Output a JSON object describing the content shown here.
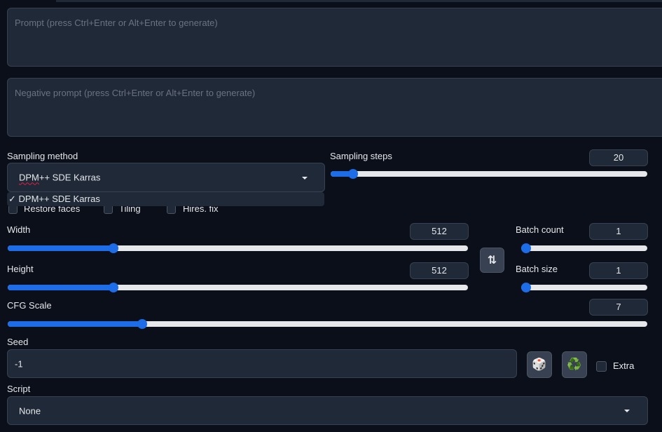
{
  "prompt": {
    "placeholder": "Prompt (press Ctrl+Enter or Alt+Enter to generate)"
  },
  "negative_prompt": {
    "placeholder": "Negative prompt (press Ctrl+Enter or Alt+Enter to generate)"
  },
  "sampling_method": {
    "label": "Sampling method",
    "value_part1": "DPM",
    "value_part2": "++ SDE Karras",
    "dropdown_option": "✓ DPM++ SDE Karras"
  },
  "sampling_steps": {
    "label": "Sampling steps",
    "value": "20",
    "fraction": 0.07
  },
  "checkboxes": {
    "restore_faces": "Restore faces",
    "tiling": "Tiling",
    "hires_fix": "Hires. fix"
  },
  "width": {
    "label": "Width",
    "value": "512",
    "fraction": 0.23
  },
  "height": {
    "label": "Height",
    "value": "512",
    "fraction": 0.23
  },
  "batch_count": {
    "label": "Batch count",
    "value": "1",
    "fraction": 0.0
  },
  "batch_size": {
    "label": "Batch size",
    "value": "1",
    "fraction": 0.0
  },
  "swap_icon": "⇅",
  "cfg_scale": {
    "label": "CFG Scale",
    "value": "7",
    "fraction": 0.21
  },
  "seed": {
    "label": "Seed",
    "value": "-1",
    "dice_icon": "🎲",
    "recycle_icon": "♻️",
    "extra_label": "Extra"
  },
  "script": {
    "label": "Script",
    "value": "None"
  },
  "colors": {
    "accent": "#1d6ce8",
    "background": "#0b0f19",
    "panel": "#1f2937"
  }
}
